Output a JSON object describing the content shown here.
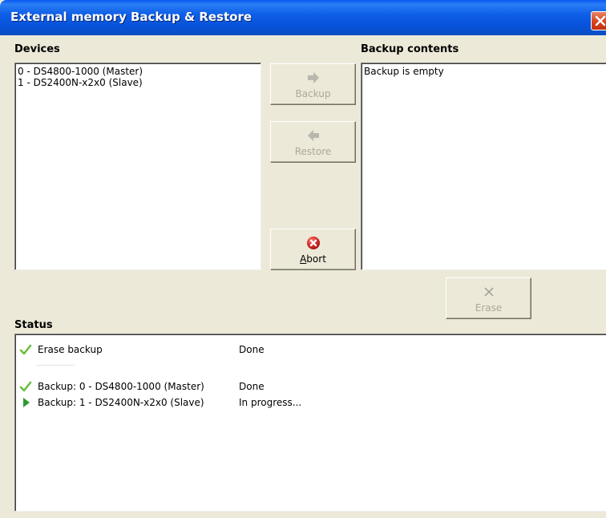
{
  "window": {
    "title": "External memory Backup & Restore"
  },
  "devices": {
    "label": "Devices",
    "items": [
      "0 - DS4800-1000 (Master)",
      "1 - DS2400N-x2x0 (Slave)"
    ]
  },
  "backup_contents": {
    "label": "Backup contents",
    "items": [
      "Backup is empty"
    ]
  },
  "buttons": {
    "backup": {
      "label": "Backup",
      "icon": "arrow-right-icon",
      "enabled": false
    },
    "restore": {
      "label": "Restore",
      "icon": "arrow-left-icon",
      "enabled": false
    },
    "abort": {
      "label_prefix": "A",
      "label_rest": "bort",
      "icon": "abort-icon",
      "enabled": true
    },
    "erase": {
      "label": "Erase",
      "icon": "x-icon",
      "enabled": false
    }
  },
  "status": {
    "label": "Status",
    "rows": [
      {
        "name": "Erase backup",
        "state": "Done",
        "icon": "checkmark-icon"
      },
      {
        "name": "Backup: 0 - DS4800-1000 (Master)",
        "state": "Done",
        "icon": "checkmark-icon"
      },
      {
        "name": "Backup: 1 - DS2400N-x2x0 (Slave)",
        "state": "In progress...",
        "icon": "play-arrow-icon"
      }
    ]
  },
  "colors": {
    "titlebar": "#0752d8",
    "dialog_background": "#ece9d8",
    "disabled_text": "#aca899",
    "checkmark": "#6bbf3c",
    "abort_red": "#d92b2b",
    "progress_arrow": "#2f9a2f"
  }
}
